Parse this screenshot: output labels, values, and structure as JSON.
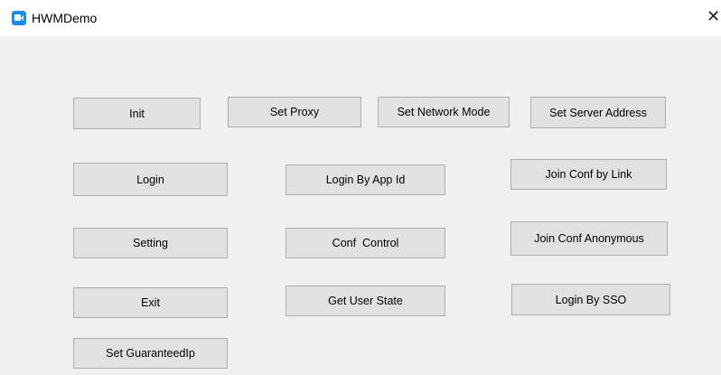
{
  "window": {
    "title": "HWMDemo",
    "close_glyph": "✕",
    "app_icon": "video-camera-icon",
    "accent_color": "#1a8cf0"
  },
  "buttons": {
    "init": "Init",
    "set_proxy": "Set Proxy",
    "set_network_mode": "Set Network Mode",
    "set_server_address": "Set Server Address",
    "login": "Login",
    "login_by_app_id": "Login By App Id",
    "join_conf_by_link": "Join Conf by Link",
    "setting": "Setting",
    "conf_control": "Conf  Control",
    "join_conf_anonymous": "Join Conf Anonymous",
    "exit": "Exit",
    "get_user_state": "Get User State",
    "login_by_sso": "Login By SSO",
    "set_guaranteed_ip": "Set GuaranteedIp"
  }
}
